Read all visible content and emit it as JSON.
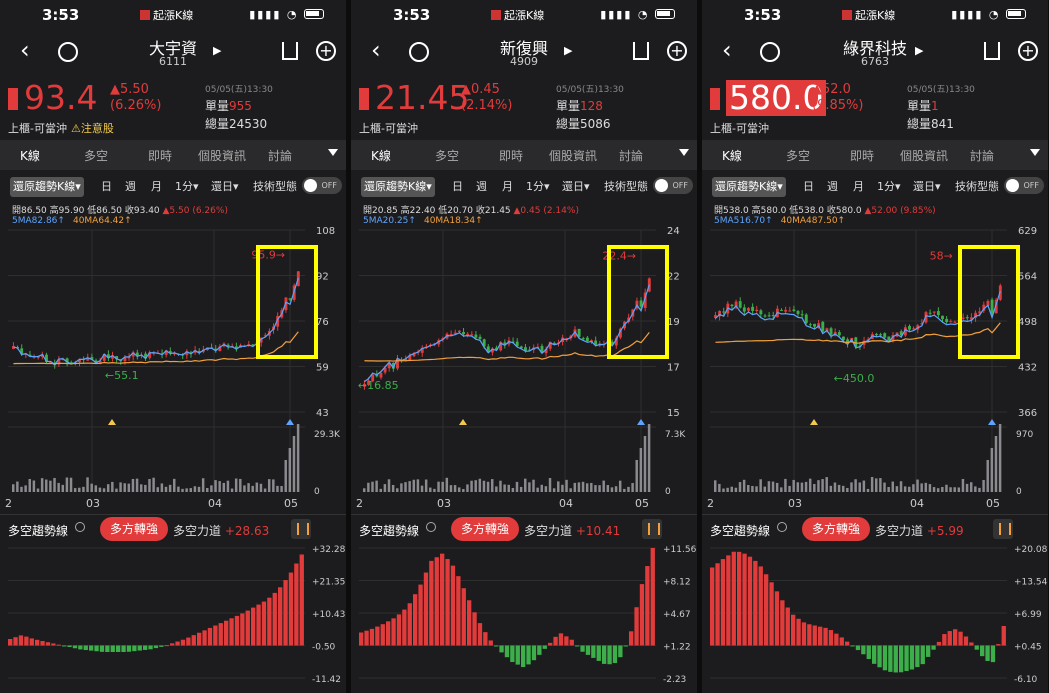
{
  "status_time": "3:53",
  "status_app": "起漲K線",
  "tabs": [
    "K線",
    "多空",
    "即時",
    "個股資訊",
    "討論"
  ],
  "controls": {
    "trend": "還原趨勢K線▾",
    "day": "日",
    "week": "週",
    "month": "月",
    "minute": "1分▾",
    "range": "還日▾",
    "tech": "技術型態",
    "off": "OFF"
  },
  "osc_title": "多空趨勢線",
  "osc_force_label": "多空力道",
  "panels": [
    {
      "name": "大宇資",
      "code": "6111",
      "price": "93.4",
      "change": "▲5.50",
      "pct": "(6.26%)",
      "date": "05/05(五)13:30",
      "vol_label": "單量",
      "vol": "955",
      "total_label": "總量",
      "total": "24530",
      "trade": "上櫃-可當沖",
      "warn": "⚠注意股",
      "price_box": false,
      "ohlc": "開86.50 高95.90 低86.50 收93.40",
      "ohlc_chg": "▲5.50 (6.26%)",
      "ma5": "5MA82.86↑",
      "ma40": "40MA64.42↑",
      "y_ticks": [
        "108",
        "92",
        "76",
        "59",
        "43"
      ],
      "vol_ticks": [
        "29.3K",
        "0"
      ],
      "months": [
        "2",
        "03",
        "04",
        "05"
      ],
      "high_label": "95.9",
      "low_label": "55.1",
      "badge": "多方轉強",
      "force": "+28.63",
      "osc_ticks": [
        "+32.28",
        "+21.35",
        "+10.43",
        "-0.50",
        "-11.42"
      ],
      "chart_data": {
        "type": "candlestick",
        "close_last": 93.4,
        "y_range": [
          43,
          108
        ],
        "volume_max": 29300,
        "osc_range": [
          -11.42,
          32.28
        ],
        "osc_last": 28.63
      }
    },
    {
      "name": "新復興",
      "code": "4909",
      "price": "21.45",
      "change": "▲0.45",
      "pct": "(2.14%)",
      "date": "05/05(五)13:30",
      "vol_label": "單量",
      "vol": "128",
      "total_label": "總量",
      "total": "5086",
      "trade": "上櫃-可當沖",
      "warn": "",
      "price_box": false,
      "ohlc": "開20.85 高22.40 低20.70 收21.45",
      "ohlc_chg": "▲0.45 (2.14%)",
      "ma5": "5MA20.25↑",
      "ma40": "40MA18.34↑",
      "y_ticks": [
        "24",
        "22",
        "19",
        "17",
        "15"
      ],
      "vol_ticks": [
        "7.3K",
        "0"
      ],
      "months": [
        "2",
        "03",
        "04",
        "05"
      ],
      "high_label": "22.4",
      "low_label": "16.85",
      "badge": "多方轉強",
      "force": "+10.41",
      "osc_ticks": [
        "+11.56",
        "+8.12",
        "+4.67",
        "+1.22",
        "-2.23"
      ],
      "chart_data": {
        "type": "candlestick",
        "close_last": 21.45,
        "y_range": [
          15,
          24
        ],
        "volume_max": 7300,
        "osc_range": [
          -2.23,
          11.56
        ],
        "osc_last": 10.41
      }
    },
    {
      "name": "綠界科技",
      "code": "6763",
      "price": "580.0",
      "change": "▲52.0",
      "pct": "(9.85%)",
      "date": "05/05(五)13:30",
      "vol_label": "單量",
      "vol": "1",
      "total_label": "總量",
      "total": "841",
      "trade": "上櫃-可當沖",
      "warn": "",
      "price_box": true,
      "ohlc": "開538.0 高580.0 低538.0 收580.0",
      "ohlc_chg": "▲52.00 (9.85%)",
      "ma5": "5MA516.70↑",
      "ma40": "40MA487.50↑",
      "y_ticks": [
        "629",
        "564",
        "498",
        "432",
        "366"
      ],
      "vol_ticks": [
        "970",
        "0"
      ],
      "months": [
        "2",
        "03",
        "04",
        "05"
      ],
      "high_label": "58",
      "low_label": "450.0",
      "badge": "多方轉強",
      "force": "+5.99",
      "osc_ticks": [
        "+20.08",
        "+13.54",
        "+6.99",
        "+0.45",
        "-6.10"
      ],
      "chart_data": {
        "type": "candlestick",
        "close_last": 580.0,
        "y_range": [
          366,
          629
        ],
        "volume_max": 970,
        "osc_range": [
          -6.1,
          20.08
        ],
        "osc_last": 5.99
      }
    }
  ]
}
